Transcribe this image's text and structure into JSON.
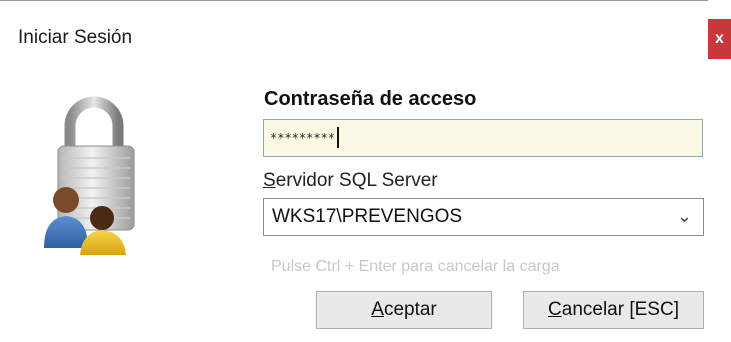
{
  "window": {
    "title": "Iniciar Sesión",
    "close_label": "x"
  },
  "login": {
    "heading": "Contraseña de acceso",
    "password_value": "*********",
    "server_label_mnemonic": "S",
    "server_label_rest": "ervidor SQL Server",
    "server_value": "WKS17\\PREVENGOS",
    "hint": "Pulse Ctrl + Enter para cancelar la carga"
  },
  "buttons": {
    "accept_mnemonic": "A",
    "accept_rest": "ceptar",
    "cancel_mnemonic": "C",
    "cancel_rest": "ancelar [ESC]"
  },
  "icons": {
    "lock": "lock-users-icon",
    "chevron": "chevron-down-icon"
  },
  "colors": {
    "close_bg": "#c8373a",
    "password_bg": "#fbf8e3",
    "hint": "#c8c8c8"
  }
}
